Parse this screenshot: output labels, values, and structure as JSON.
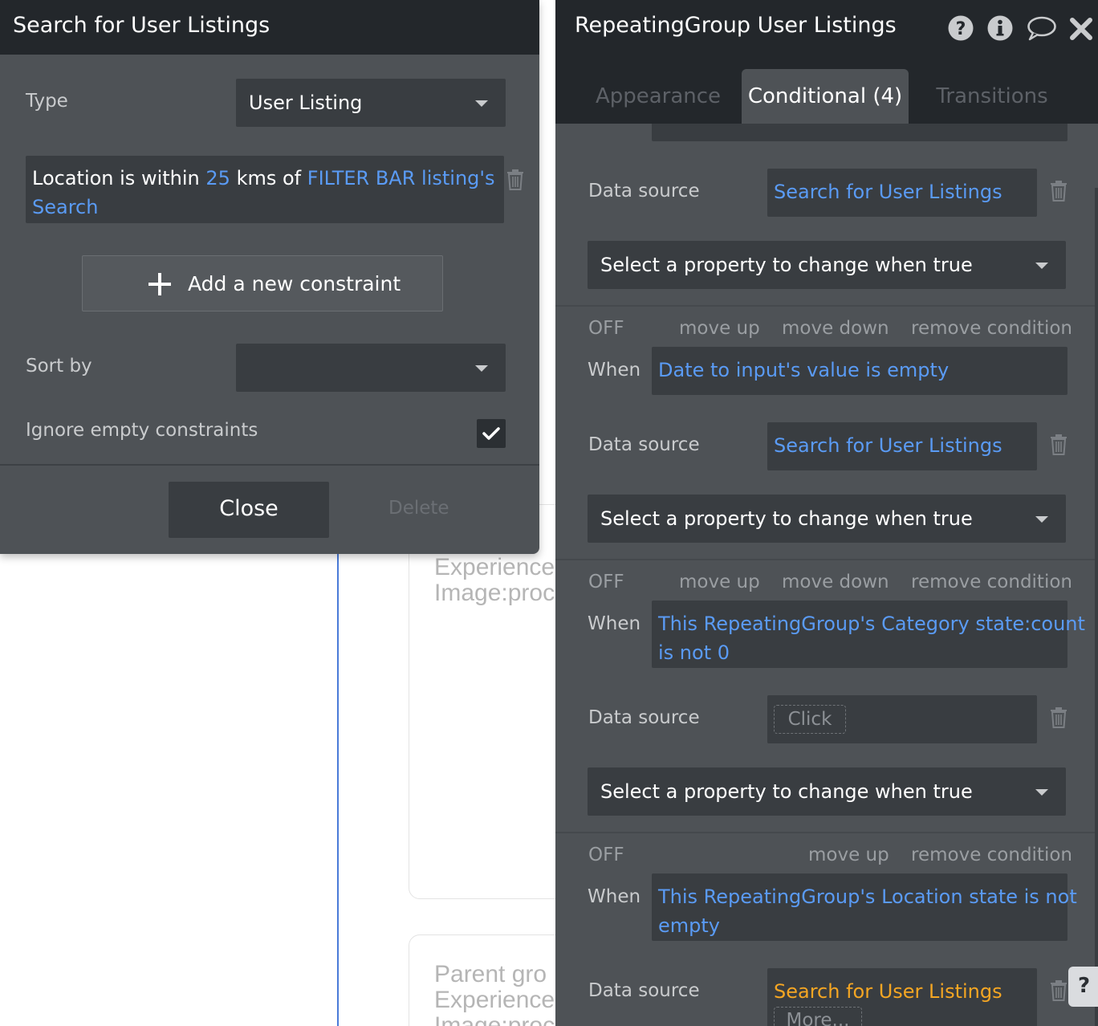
{
  "search_popup": {
    "title": "Search for User Listings",
    "type_label": "Type",
    "type_value": "User Listing",
    "constraint": {
      "prefix": "Location is within",
      "distance": "25",
      "unit": "kms",
      "of_word": "of",
      "source_line1": "FILTER BAR listing's",
      "source_line2": "Search"
    },
    "add_constraint_label": "Add a new constraint",
    "sort_by_label": "Sort by",
    "sort_by_value": "",
    "ignore_empty_label": "Ignore empty constraints",
    "ignore_empty_checked": true,
    "close_label": "Close",
    "delete_label": "Delete"
  },
  "panel": {
    "title": "RepeatingGroup User Listings",
    "tabs": [
      {
        "label": "Appearance",
        "active": false
      },
      {
        "label": "Conditional (4)",
        "active": true
      },
      {
        "label": "Transitions",
        "active": false
      }
    ],
    "header_icons": [
      "help-icon",
      "info-icon",
      "comment-icon",
      "close-icon"
    ],
    "conditions": [
      {
        "data_source_label": "Data source",
        "data_source_value": "Search for User Listings",
        "property_placeholder": "Select a property to change when true"
      },
      {
        "off_label": "OFF",
        "move_up": "move up",
        "move_down": "move down",
        "remove": "remove condition",
        "when_label": "When",
        "when_value": "Date to input's value is empty",
        "data_source_label": "Data source",
        "data_source_value": "Search for User Listings",
        "property_placeholder": "Select a property to change when true"
      },
      {
        "off_label": "OFF",
        "move_up": "move up",
        "move_down": "move down",
        "remove": "remove condition",
        "when_label": "When",
        "when_line1": "This RepeatingGroup's Category state:count",
        "when_line2": "is not 0",
        "data_source_label": "Data source",
        "data_source_placeholder": "Click",
        "property_placeholder": "Select a property to change when true"
      },
      {
        "off_label": "OFF",
        "move_up": "move up",
        "remove": "remove condition",
        "when_label": "When",
        "when_line1": "This RepeatingGroup's Location state is not",
        "when_line2": "empty",
        "data_source_label": "Data source",
        "data_source_value": "Search for User Listings",
        "data_source_more": "More..."
      }
    ]
  },
  "canvas": {
    "card1_lines": [
      "Experience",
      "Image:proc"
    ],
    "card2_lines": [
      "Parent gro",
      "Experience",
      "Image:proc"
    ]
  },
  "help_button": "?",
  "colors": {
    "panel_bg": "#4e5256",
    "header_bg": "#23272b",
    "field_bg": "#393d41",
    "link_blue": "#5a9bf5",
    "warning_orange": "#f5a623"
  }
}
